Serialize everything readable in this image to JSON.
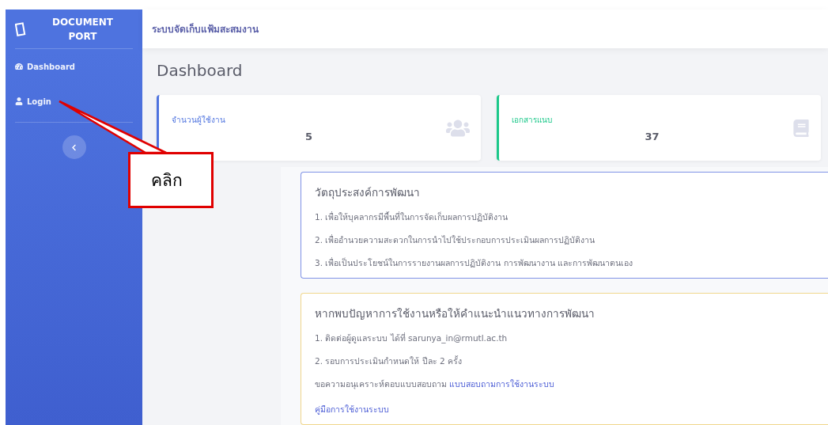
{
  "brand": {
    "line1": "DOCUMENT",
    "line2": "PORT"
  },
  "sidebar": {
    "items": [
      {
        "label": "Dashboard",
        "kind": "gauge",
        "selected": false
      },
      {
        "label": "Login",
        "kind": "user",
        "selected": false
      }
    ]
  },
  "topbar": {
    "title": "ระบบจัดเก็บแฟ้มสะสมงาน"
  },
  "page_title": "Dashboard",
  "stats": [
    {
      "label": "จำนวนผู้ใช้งาน",
      "value": "5",
      "kind": "users",
      "color": "#4e73df"
    },
    {
      "label": "เอกสารแนบ",
      "value": "37",
      "kind": "book",
      "color": "#1cc88a"
    }
  ],
  "panels": [
    {
      "title": "วัตถุประสงค์การพัฒนา",
      "color": "#8093e6",
      "lines": [
        {
          "text": "1. เพื่อให้บุคลากรมีพื้นที่ในการจัดเก็บผลการปฏิบัติงาน"
        },
        {
          "text": "2. เพื่ออำนวยความสะดวกในการนำไปใช้ประกอบการประเมินผลการปฏิบัติงาน"
        },
        {
          "text": "3. เพื่อเป็นประโยชน์ในการรายงานผลการปฏิบัติงาน การพัฒนางาน และการพัฒนาตนเอง"
        }
      ]
    },
    {
      "title": "หากพบปัญหาการใช้งานหรือให้คำแนะนำแนวทางการพัฒนา",
      "color": "#f0d78c",
      "lines": [
        {
          "text": "1. ติดต่อผู้ดูแลระบบ ได้ที่ sarunya_in@rmutl.ac.th"
        },
        {
          "text": "2. รอบการประเมินกำหนดให้ ปีละ 2 ครั้ง"
        },
        {
          "text": "ขอความอนุเคราะห์ตอบแบบสอบถาม",
          "link": "แบบสอบถามการใช้งานระบบ"
        },
        {
          "link": "คู่มือการใช้งานระบบ"
        }
      ]
    }
  ],
  "callout": {
    "text": "คลิก"
  }
}
